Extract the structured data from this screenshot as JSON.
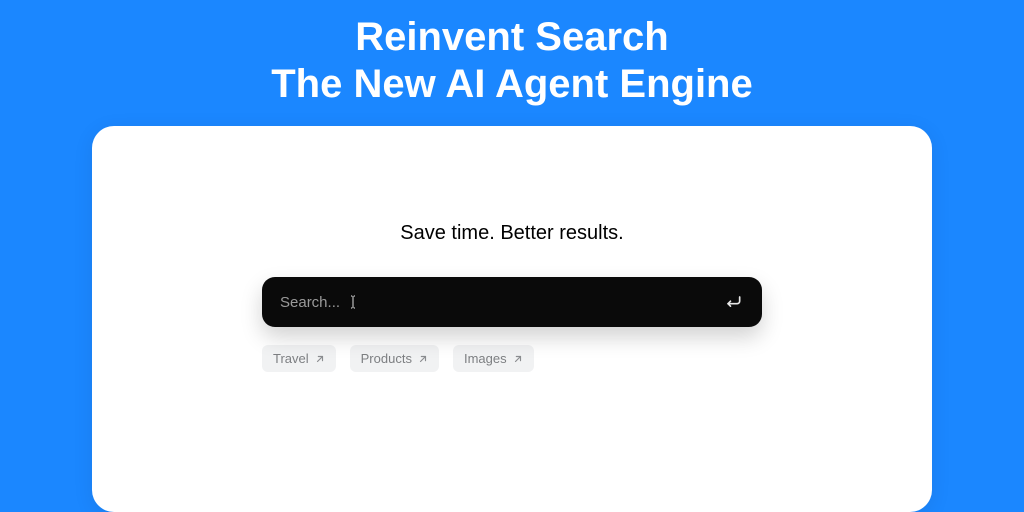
{
  "hero": {
    "line1": "Reinvent Search",
    "line2": "The New AI Agent Engine"
  },
  "card": {
    "tagline": "Save time. Better results.",
    "search": {
      "placeholder": "Search...",
      "value": ""
    },
    "chips": [
      {
        "label": "Travel"
      },
      {
        "label": "Products"
      },
      {
        "label": "Images"
      }
    ]
  },
  "icons": {
    "submit": "return-arrow-icon",
    "chip_arrow": "arrow-up-right-icon",
    "cursor": "text-cursor-icon"
  },
  "colors": {
    "background": "#1b87ff",
    "card": "#ffffff",
    "searchbar": "#0a0a0a",
    "chip": "#f1f2f3"
  }
}
